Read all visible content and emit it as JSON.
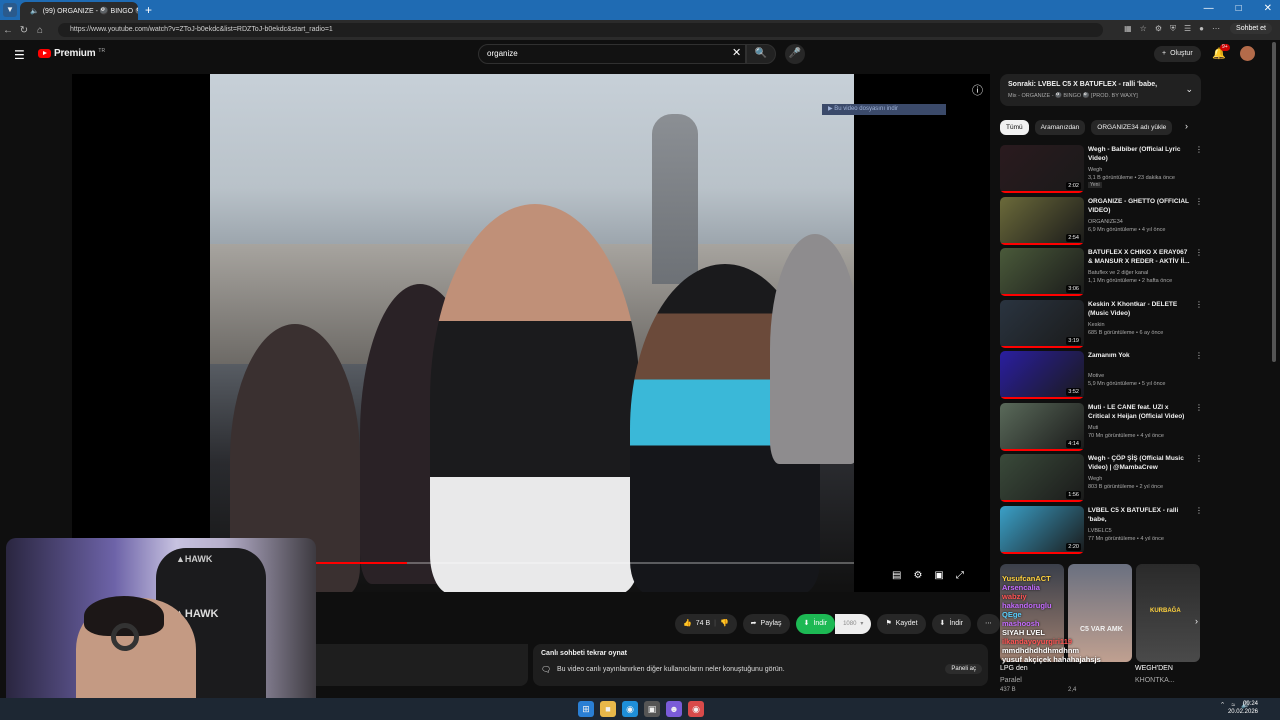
{
  "browser": {
    "tab_title": "(99) ORGANIZE - 🎱 BINGO 🎱",
    "url": "https://www.youtube.com/watch?v=ZToJ-b0ekdc&list=RDZToJ-b0ekdc&start_radio=1",
    "copilot_label": "Sohbet et"
  },
  "header": {
    "logo_text": "Premium",
    "logo_region": "TR",
    "search_value": "organize",
    "create_label": "Oluştur",
    "notification_count": "9+"
  },
  "player": {
    "download_banner": "▶ Bu video dosyasını indir",
    "progress_fraction": 0.17
  },
  "actions": {
    "like_count": "74 B",
    "share_label": "Paylaş",
    "download_label": "İndir",
    "quality_label": "1080",
    "save_label": "Kaydet",
    "download2_label": "İndir"
  },
  "chat_replay": {
    "title": "Canlı sohbeti tekrar oynat",
    "text": "Bu video canlı yayınlanırken diğer kullanıcıların neler konuştuğunu görün.",
    "button": "Paneli aç"
  },
  "up_next": {
    "title": "Sonraki: LVBEL C5 X BATUFLEX - ralli 'babe,",
    "subtitle": "Mix - ORGANIZE - 🎱 BINGO 🎱 [PROD. BY WAXY]"
  },
  "chips": [
    "Tümü",
    "Aramanızdan",
    "ORGANIZE34 adı yükle"
  ],
  "recommendations": [
    {
      "title": "Wegh - Balbiber (Official Lyric Video)",
      "channel": "Wegh",
      "meta": "3,1 B görüntüleme • 23 dakika önce",
      "duration": "2:02",
      "badge": "Yeni",
      "thumb": "#2a1a1e"
    },
    {
      "title": "ORGANIZE - GHETTO (OFFICIAL VIDEO)",
      "channel": "ORGANIZE34",
      "meta": "6,9 Mn görüntüleme • 4 yıl önce",
      "duration": "2:54",
      "badge": "",
      "thumb": "#6b6a3a"
    },
    {
      "title": "BATUFLEX X CHIKO X ERAY067 & MANSUR X REDER - AKTİV İİ...",
      "channel": "Batuflex ve 2 diğer kanal",
      "meta": "1,1 Mn görüntüleme • 2 hafta önce",
      "duration": "3:06",
      "badge": "",
      "thumb": "#4a5a3a"
    },
    {
      "title": "Keskin X Khontkar - DELETE (Music Video)",
      "channel": "Keskin",
      "meta": "685 B görüntüleme • 6 ay önce",
      "duration": "3:19",
      "badge": "",
      "thumb": "#2a3440"
    },
    {
      "title": "Zamanım Yok",
      "channel": "Motive",
      "meta": "5,9 Mn görüntüleme • 5 yıl önce",
      "duration": "3:52",
      "badge": "",
      "thumb": "#2a1ea0"
    },
    {
      "title": "Muti - LE CANE feat. UZI x Critical x Heijan (Official Video)",
      "channel": "Muti",
      "meta": "70 Mn görüntüleme • 4 yıl önce",
      "duration": "4:14",
      "badge": "",
      "thumb": "#5a6a5a"
    },
    {
      "title": "Wegh - ÇÖP ŞİŞ (Official Music Video) | @MambaCrew",
      "channel": "Wegh",
      "meta": "803 B görüntüleme • 2 yıl önce",
      "duration": "1:56",
      "badge": "",
      "thumb": "#3a4a3a"
    },
    {
      "title": "LVBEL C5 X BATUFLEX - ralli 'babe,",
      "channel": "LVBELC5",
      "meta": "77 Mn görüntüleme • 4 yıl önce",
      "duration": "2:20",
      "badge": "",
      "thumb": "#3aa0c8"
    }
  ],
  "shorts_overlay": {
    "short_labels": [
      "C5 VAR AMK",
      "KURBAĞA"
    ],
    "bottom_titles": [
      "LPG den",
      "WEGH'DEN"
    ],
    "bottom_meta": [
      "Paralel",
      "KHONTKA..."
    ],
    "bottom_views": [
      "437 B",
      "2,4"
    ]
  },
  "chat_messages": [
    {
      "user": "YusufcanACT",
      "color": "c-yellow"
    },
    {
      "user": "Arsencalia",
      "color": "c-purple"
    },
    {
      "user": "wabziy",
      "color": "c-red"
    },
    {
      "user": "hakandoruglu",
      "color": "c-purple"
    },
    {
      "user": "QEge",
      "color": "c-cyan"
    },
    {
      "user": "mashoosh",
      "color": "c-purple"
    },
    {
      "user": "SIYAH LVEL",
      "color": ""
    },
    {
      "user": "ilkandayoyurgiri119",
      "color": "c-red"
    },
    {
      "user": "mmdhdhdhdhmdhnm",
      "color": ""
    },
    {
      "user": "yusuf akçiçek hahahajahsjs",
      "color": ""
    }
  ],
  "taskbar": {
    "time": "00:24",
    "date": "20.02.2026"
  }
}
